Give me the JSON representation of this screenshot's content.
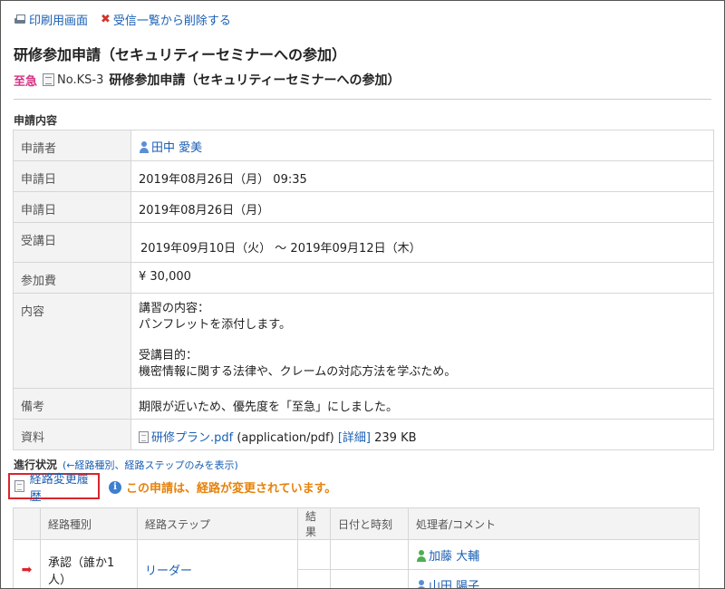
{
  "toolbar": {
    "print_label": "印刷用画面",
    "delete_label": "受信一覧から削除する"
  },
  "title": "研修参加申請（セキュリティーセミナーへの参加）",
  "subtitle": {
    "priority": "至急",
    "doc_no": "No.KS-3",
    "text": "研修参加申請（セキュリティーセミナーへの参加）"
  },
  "section_content": "申請内容",
  "details": {
    "applicant_label": "申請者",
    "applicant": "田中 愛美",
    "apply_datetime_label": "申請日",
    "apply_datetime": "2019年08月26日（月） 09:35",
    "apply_date_label": "申請日",
    "apply_date": "2019年08月26日（月）",
    "course_date_label": "受講日",
    "course_date": "2019年09月10日（火） ～ 2019年09月12日（木）",
    "fee_label": "参加費",
    "fee": "¥ 30,000",
    "content_label": "内容",
    "content_line1": "講習の内容：",
    "content_line2": "パンフレットを添付します。",
    "content_line3": "受講目的：",
    "content_line4": "機密情報に関する法律や、クレームの対応方法を学ぶため。",
    "note_label": "備考",
    "note": "期限が近いため、優先度を「至急」にしました。",
    "material_label": "資料",
    "file_name": "研修プラン.pdf",
    "file_type": "(application/pdf)",
    "file_detail": "[詳細]",
    "file_size": "239 KB"
  },
  "progress": {
    "label": "進行状況",
    "show_link": "(←経路種別、経路ステップのみを表示)",
    "history_button": "経路変更履歴",
    "notice": "この申請は、経路が変更されています。"
  },
  "route_table": {
    "headers": [
      "",
      "経路種別",
      "経路ステップ",
      "結果",
      "日付と時刻",
      "処理者/コメント"
    ],
    "row": {
      "type": "承認（誰か1人）",
      "step": "リーダー",
      "processor1": "加藤 大輔",
      "processor2": "山田 陽子"
    }
  },
  "colors": {
    "link": "#1a5fb4",
    "urgent": "#d63384",
    "notice": "#e6820a",
    "highlight_border": "#d9262c"
  }
}
